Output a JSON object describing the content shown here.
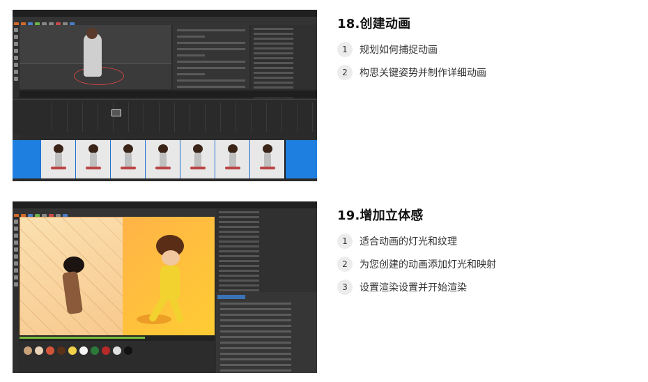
{
  "sections": [
    {
      "title": "18.创建动画",
      "steps": [
        {
          "num": "1",
          "text": "规划如何捕捉动画"
        },
        {
          "num": "2",
          "text": "构思关键姿势并制作详细动画"
        }
      ]
    },
    {
      "title": "19.增加立体感",
      "steps": [
        {
          "num": "1",
          "text": "适合动画的灯光和纹理"
        },
        {
          "num": "2",
          "text": "为您创建的动画添加灯光和映射"
        },
        {
          "num": "3",
          "text": "设置渲染设置并开始渲染"
        }
      ]
    }
  ],
  "colors": {
    "accent_blue": "#1f7fe0",
    "viewport_orange": "#ffb347",
    "number_badge_bg": "#ececec"
  }
}
